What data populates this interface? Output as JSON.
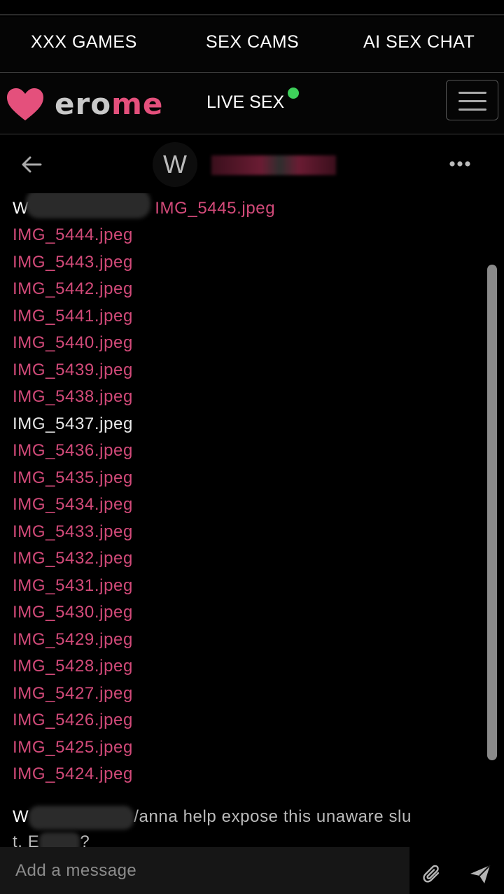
{
  "promo_nav": {
    "items": [
      "XXX GAMES",
      "SEX CAMS",
      "AI SEX CHAT"
    ]
  },
  "header": {
    "logo_text_a": "ero",
    "logo_text_b": "me",
    "live_sex_label": "LIVE SEX",
    "live_dot_color": "#3ecf5a"
  },
  "chat_header": {
    "avatar_initial": "W"
  },
  "message1": {
    "sender_initial": "W",
    "files": [
      "IMG_5445.jpeg",
      "IMG_5444.jpeg",
      "IMG_5443.jpeg",
      "IMG_5442.jpeg",
      "IMG_5441.jpeg",
      "IMG_5440.jpeg",
      "IMG_5439.jpeg",
      "IMG_5438.jpeg",
      "IMG_5437.jpeg",
      "IMG_5436.jpeg",
      "IMG_5435.jpeg",
      "IMG_5434.jpeg",
      "IMG_5433.jpeg",
      "IMG_5432.jpeg",
      "IMG_5431.jpeg",
      "IMG_5430.jpeg",
      "IMG_5429.jpeg",
      "IMG_5428.jpeg",
      "IMG_5427.jpeg",
      "IMG_5426.jpeg",
      "IMG_5425.jpeg",
      "IMG_5424.jpeg"
    ]
  },
  "message2": {
    "sender_initial": "W",
    "text_a": "/anna help expose this unaware slu",
    "text_b": "t. E",
    "text_c": "?"
  },
  "composer": {
    "placeholder": "Add a message"
  },
  "colors": {
    "accent_pink": "#d24a79",
    "background": "#000000"
  }
}
